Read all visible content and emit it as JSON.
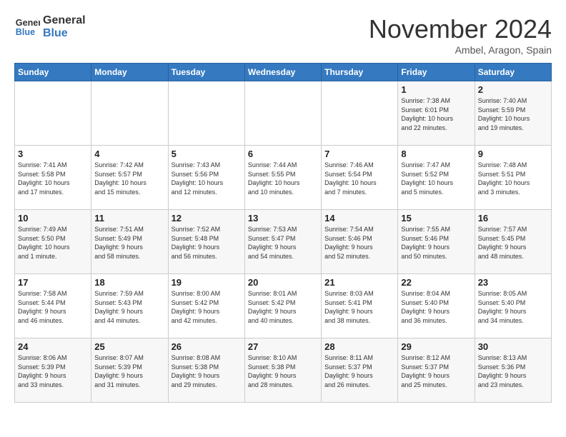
{
  "header": {
    "logo_line1": "General",
    "logo_line2": "Blue",
    "month": "November 2024",
    "location": "Ambel, Aragon, Spain"
  },
  "days_of_week": [
    "Sunday",
    "Monday",
    "Tuesday",
    "Wednesday",
    "Thursday",
    "Friday",
    "Saturday"
  ],
  "weeks": [
    [
      {
        "day": "",
        "info": ""
      },
      {
        "day": "",
        "info": ""
      },
      {
        "day": "",
        "info": ""
      },
      {
        "day": "",
        "info": ""
      },
      {
        "day": "",
        "info": ""
      },
      {
        "day": "1",
        "info": "Sunrise: 7:38 AM\nSunset: 6:01 PM\nDaylight: 10 hours\nand 22 minutes."
      },
      {
        "day": "2",
        "info": "Sunrise: 7:40 AM\nSunset: 5:59 PM\nDaylight: 10 hours\nand 19 minutes."
      }
    ],
    [
      {
        "day": "3",
        "info": "Sunrise: 7:41 AM\nSunset: 5:58 PM\nDaylight: 10 hours\nand 17 minutes."
      },
      {
        "day": "4",
        "info": "Sunrise: 7:42 AM\nSunset: 5:57 PM\nDaylight: 10 hours\nand 15 minutes."
      },
      {
        "day": "5",
        "info": "Sunrise: 7:43 AM\nSunset: 5:56 PM\nDaylight: 10 hours\nand 12 minutes."
      },
      {
        "day": "6",
        "info": "Sunrise: 7:44 AM\nSunset: 5:55 PM\nDaylight: 10 hours\nand 10 minutes."
      },
      {
        "day": "7",
        "info": "Sunrise: 7:46 AM\nSunset: 5:54 PM\nDaylight: 10 hours\nand 7 minutes."
      },
      {
        "day": "8",
        "info": "Sunrise: 7:47 AM\nSunset: 5:52 PM\nDaylight: 10 hours\nand 5 minutes."
      },
      {
        "day": "9",
        "info": "Sunrise: 7:48 AM\nSunset: 5:51 PM\nDaylight: 10 hours\nand 3 minutes."
      }
    ],
    [
      {
        "day": "10",
        "info": "Sunrise: 7:49 AM\nSunset: 5:50 PM\nDaylight: 10 hours\nand 1 minute."
      },
      {
        "day": "11",
        "info": "Sunrise: 7:51 AM\nSunset: 5:49 PM\nDaylight: 9 hours\nand 58 minutes."
      },
      {
        "day": "12",
        "info": "Sunrise: 7:52 AM\nSunset: 5:48 PM\nDaylight: 9 hours\nand 56 minutes."
      },
      {
        "day": "13",
        "info": "Sunrise: 7:53 AM\nSunset: 5:47 PM\nDaylight: 9 hours\nand 54 minutes."
      },
      {
        "day": "14",
        "info": "Sunrise: 7:54 AM\nSunset: 5:46 PM\nDaylight: 9 hours\nand 52 minutes."
      },
      {
        "day": "15",
        "info": "Sunrise: 7:55 AM\nSunset: 5:46 PM\nDaylight: 9 hours\nand 50 minutes."
      },
      {
        "day": "16",
        "info": "Sunrise: 7:57 AM\nSunset: 5:45 PM\nDaylight: 9 hours\nand 48 minutes."
      }
    ],
    [
      {
        "day": "17",
        "info": "Sunrise: 7:58 AM\nSunset: 5:44 PM\nDaylight: 9 hours\nand 46 minutes."
      },
      {
        "day": "18",
        "info": "Sunrise: 7:59 AM\nSunset: 5:43 PM\nDaylight: 9 hours\nand 44 minutes."
      },
      {
        "day": "19",
        "info": "Sunrise: 8:00 AM\nSunset: 5:42 PM\nDaylight: 9 hours\nand 42 minutes."
      },
      {
        "day": "20",
        "info": "Sunrise: 8:01 AM\nSunset: 5:42 PM\nDaylight: 9 hours\nand 40 minutes."
      },
      {
        "day": "21",
        "info": "Sunrise: 8:03 AM\nSunset: 5:41 PM\nDaylight: 9 hours\nand 38 minutes."
      },
      {
        "day": "22",
        "info": "Sunrise: 8:04 AM\nSunset: 5:40 PM\nDaylight: 9 hours\nand 36 minutes."
      },
      {
        "day": "23",
        "info": "Sunrise: 8:05 AM\nSunset: 5:40 PM\nDaylight: 9 hours\nand 34 minutes."
      }
    ],
    [
      {
        "day": "24",
        "info": "Sunrise: 8:06 AM\nSunset: 5:39 PM\nDaylight: 9 hours\nand 33 minutes."
      },
      {
        "day": "25",
        "info": "Sunrise: 8:07 AM\nSunset: 5:39 PM\nDaylight: 9 hours\nand 31 minutes."
      },
      {
        "day": "26",
        "info": "Sunrise: 8:08 AM\nSunset: 5:38 PM\nDaylight: 9 hours\nand 29 minutes."
      },
      {
        "day": "27",
        "info": "Sunrise: 8:10 AM\nSunset: 5:38 PM\nDaylight: 9 hours\nand 28 minutes."
      },
      {
        "day": "28",
        "info": "Sunrise: 8:11 AM\nSunset: 5:37 PM\nDaylight: 9 hours\nand 26 minutes."
      },
      {
        "day": "29",
        "info": "Sunrise: 8:12 AM\nSunset: 5:37 PM\nDaylight: 9 hours\nand 25 minutes."
      },
      {
        "day": "30",
        "info": "Sunrise: 8:13 AM\nSunset: 5:36 PM\nDaylight: 9 hours\nand 23 minutes."
      }
    ]
  ]
}
